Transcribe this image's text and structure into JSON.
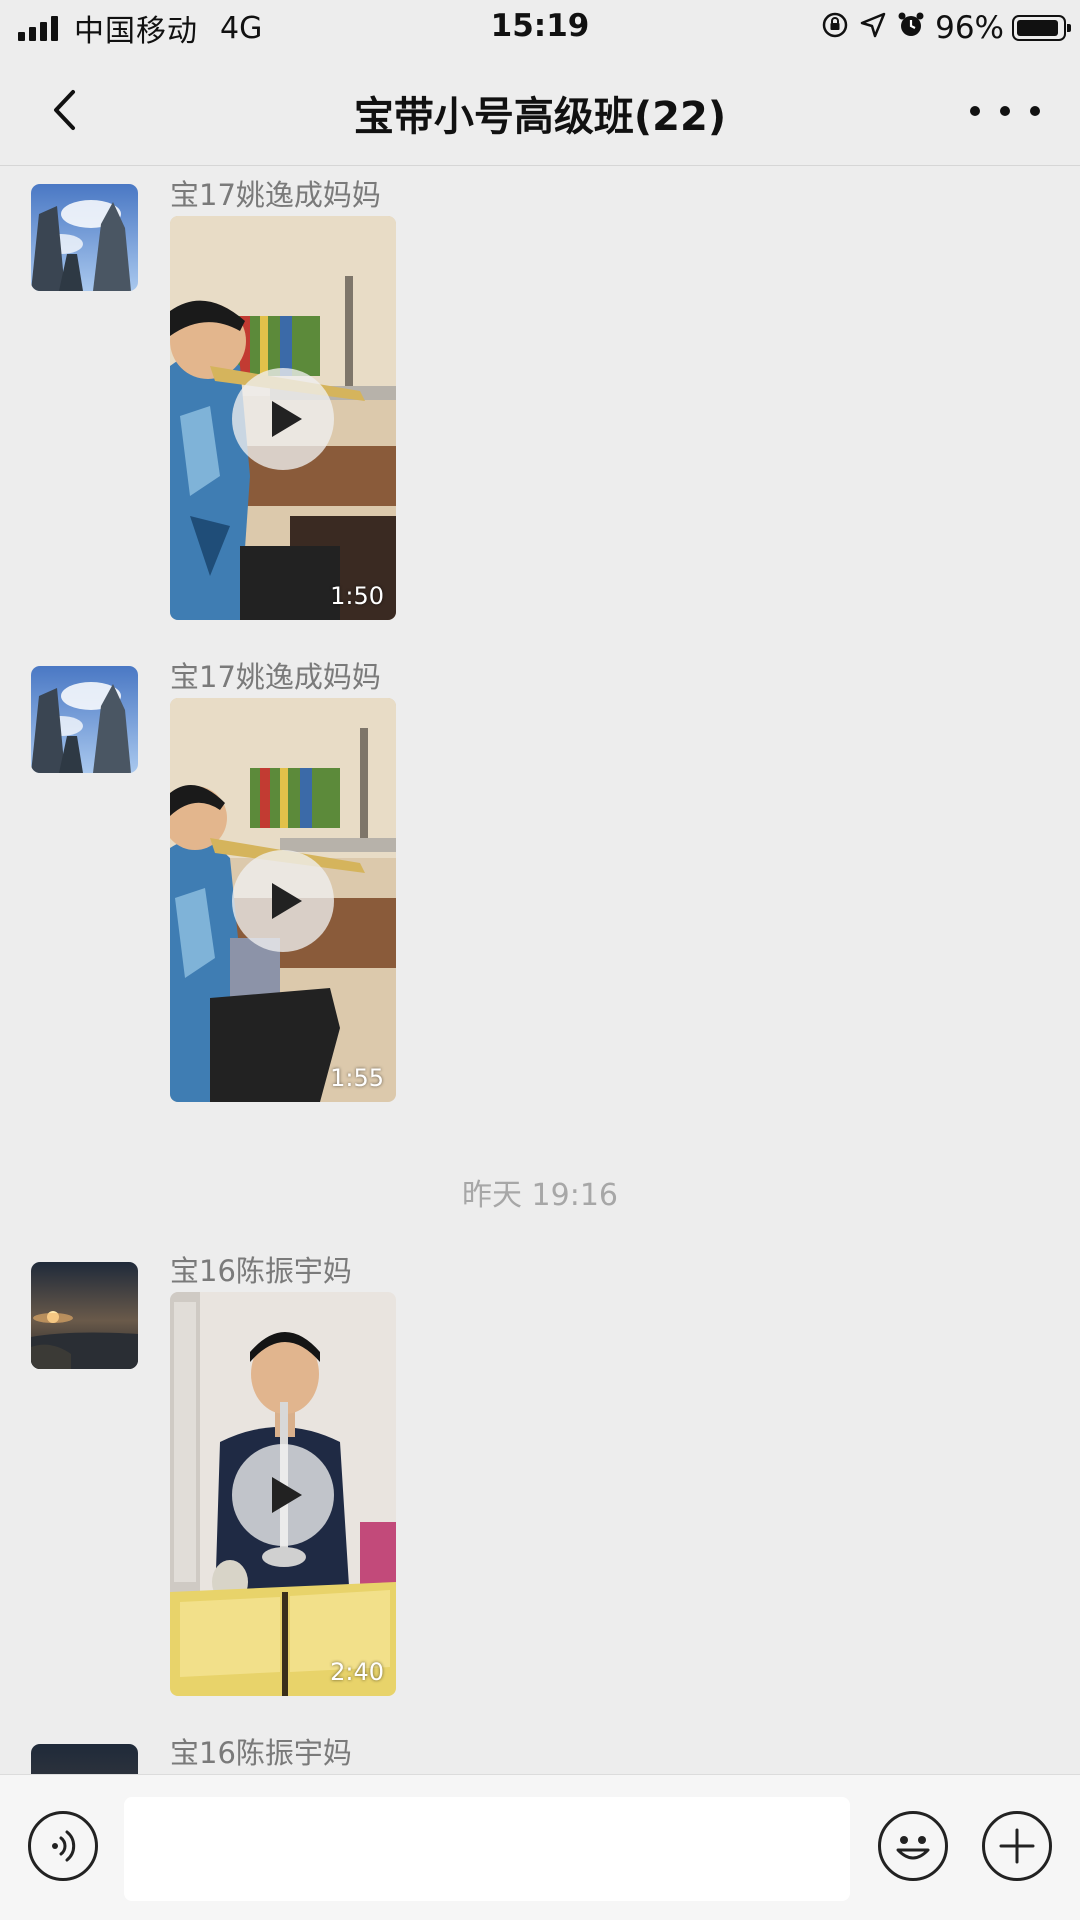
{
  "status_bar": {
    "carrier": "中国移动",
    "network": "4G",
    "time": "15:19",
    "battery_percent": "96%",
    "battery_level": 0.96,
    "icons": [
      "signal-icon",
      "orientation-lock-icon",
      "location-icon",
      "alarm-icon",
      "battery-icon"
    ]
  },
  "nav": {
    "title": "宝带小号高级班(22)",
    "back_icon": "chevron-left-icon",
    "more_icon": "more-dots-icon"
  },
  "messages": [
    {
      "sender": "宝17姚逸成妈妈",
      "type": "video",
      "duration": "1:50"
    },
    {
      "sender": "宝17姚逸成妈妈",
      "type": "video",
      "duration": "1:55"
    },
    {
      "timestamp": "昨天 19:16"
    },
    {
      "sender": "宝16陈振宇妈",
      "type": "video",
      "duration": "2:40"
    },
    {
      "sender": "宝16陈振宇妈"
    }
  ],
  "input_bar": {
    "voice_icon": "voice-icon",
    "emoji_icon": "emoji-icon",
    "plus_icon": "plus-icon",
    "text_value": ""
  },
  "colors": {
    "background": "#ededed",
    "input_bar": "#f6f6f6",
    "sender_name": "#7a7a7a",
    "timestamp": "#a7a7a7"
  }
}
